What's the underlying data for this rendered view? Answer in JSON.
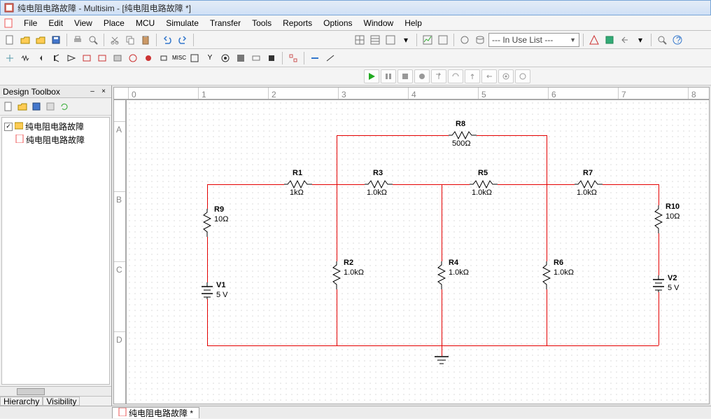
{
  "window": {
    "title": "纯电阻电路故障 - Multisim - [纯电阻电路故障 *]"
  },
  "menu": {
    "file": "File",
    "edit": "Edit",
    "view": "View",
    "place": "Place",
    "mcu": "MCU",
    "simulate": "Simulate",
    "transfer": "Transfer",
    "tools": "Tools",
    "reports": "Reports",
    "options": "Options",
    "window": "Window",
    "help": "Help"
  },
  "combo": {
    "inuse": "--- In Use List ---"
  },
  "sidebar": {
    "title": "Design Toolbox",
    "root": "纯电阻电路故障",
    "child": "纯电阻电路故障",
    "tabs": {
      "hierarchy": "Hierarchy",
      "visibility": "Visibility"
    }
  },
  "doc_tab": "纯电阻电路故障 *",
  "components": {
    "R1": {
      "name": "R1",
      "value": "1kΩ"
    },
    "R2": {
      "name": "R2",
      "value": "1.0kΩ"
    },
    "R3": {
      "name": "R3",
      "value": "1.0kΩ"
    },
    "R4": {
      "name": "R4",
      "value": "1.0kΩ"
    },
    "R5": {
      "name": "R5",
      "value": "1.0kΩ"
    },
    "R6": {
      "name": "R6",
      "value": "1.0kΩ"
    },
    "R7": {
      "name": "R7",
      "value": "1.0kΩ"
    },
    "R8": {
      "name": "R8",
      "value": "500Ω"
    },
    "R9": {
      "name": "R9",
      "value": "10Ω"
    },
    "R10": {
      "name": "R10",
      "value": "10Ω"
    },
    "V1": {
      "name": "V1",
      "value": "5 V"
    },
    "V2": {
      "name": "V2",
      "value": "5 V"
    }
  }
}
